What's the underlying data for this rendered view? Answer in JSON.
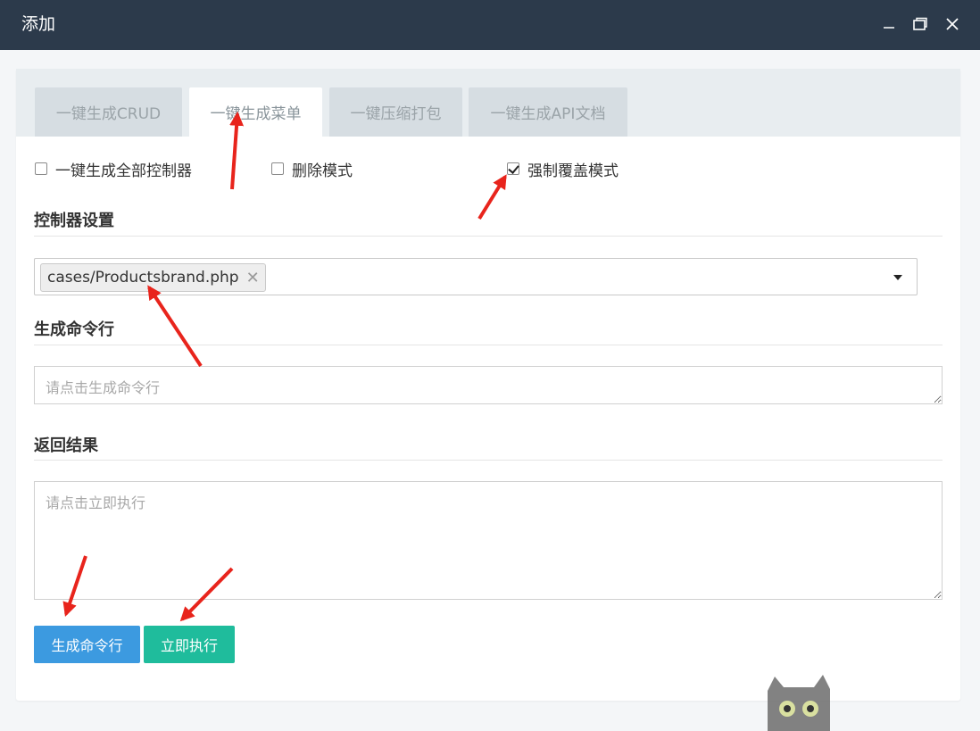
{
  "window": {
    "title": "添加",
    "minimize_label": "—",
    "maximize_label": "❐",
    "close_label": "✕"
  },
  "tabs": [
    {
      "label": "一键生成CRUD",
      "active": false
    },
    {
      "label": "一键生成菜单",
      "active": true
    },
    {
      "label": "一键压缩打包",
      "active": false
    },
    {
      "label": "一键生成API文档",
      "active": false
    }
  ],
  "options": [
    {
      "label": "一键生成全部控制器",
      "checked": false
    },
    {
      "label": "删除模式",
      "checked": false
    },
    {
      "label": "强制覆盖模式",
      "checked": true
    }
  ],
  "controller_section": {
    "title": "控制器设置",
    "selected_tag": "cases/Productsbrand.php",
    "remove_symbol": "✕"
  },
  "command_section": {
    "title": "生成命令行",
    "placeholder": "请点击生成命令行"
  },
  "result_section": {
    "title": "返回结果",
    "placeholder": "请点击立即执行"
  },
  "buttons": {
    "generate_label": "生成命令行",
    "execute_label": "立即执行"
  },
  "colors": {
    "titlebar": "#2c3a4b",
    "primary": "#3c9ae0",
    "success": "#1fbc9c",
    "annotation_arrow": "#e8241c"
  }
}
